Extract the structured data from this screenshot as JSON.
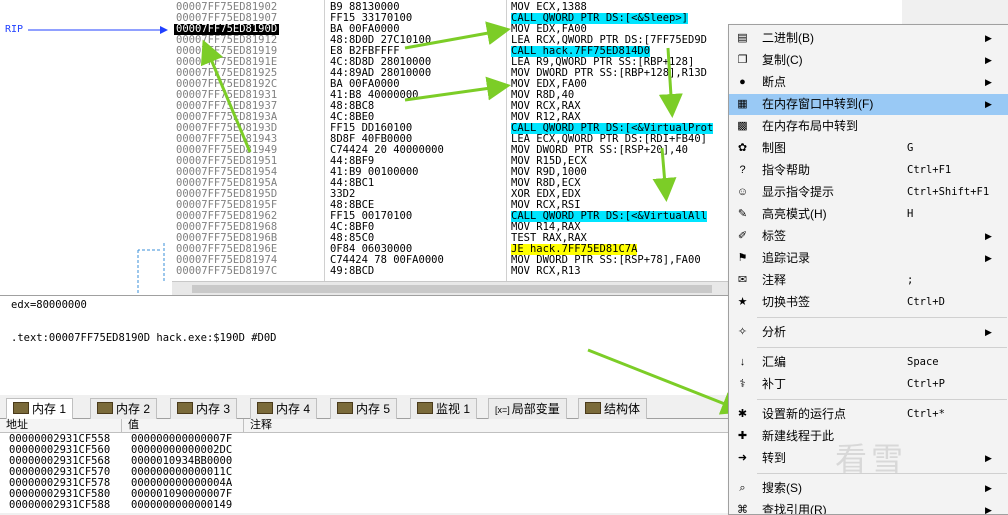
{
  "gutter": {
    "rip_label": "RIP"
  },
  "code_rows": [
    {
      "addr": "00007FF75ED81902",
      "bytes": "B9 88130000",
      "instr": "MOV ECX,1388",
      "hl": "",
      "cur": false
    },
    {
      "addr": "00007FF75ED81907",
      "bytes": "FF15 33170100",
      "instr": "CALL QWORD PTR DS:[<&Sleep>]",
      "hl": "call",
      "cur": false
    },
    {
      "addr": "00007FF75ED8190D",
      "bytes": "BA 00FA0000",
      "instr": "MOV EDX,FA00",
      "hl": "",
      "cur": true
    },
    {
      "addr": "00007FF75ED81912",
      "bytes": "48:8D0D 27C10100",
      "instr": "LEA RCX,QWORD PTR DS:[7FF75ED9D",
      "hl": "",
      "cur": false
    },
    {
      "addr": "00007FF75ED81919",
      "bytes": "E8 B2FBFFFF",
      "instr": "CALL hack.7FF75ED814D0",
      "hl": "call",
      "cur": false
    },
    {
      "addr": "00007FF75ED8191E",
      "bytes": "4C:8D8D 28010000",
      "instr": "LEA R9,QWORD PTR SS:[RBP+128]",
      "hl": "",
      "cur": false
    },
    {
      "addr": "00007FF75ED81925",
      "bytes": "44:89AD 28010000",
      "instr": "MOV DWORD PTR SS:[RBP+128],R13D",
      "hl": "",
      "cur": false
    },
    {
      "addr": "00007FF75ED8192C",
      "bytes": "BA 00FA0000",
      "instr": "MOV EDX,FA00",
      "hl": "",
      "cur": false
    },
    {
      "addr": "00007FF75ED81931",
      "bytes": "41:B8 40000000",
      "instr": "MOV R8D,40",
      "hl": "",
      "cur": false
    },
    {
      "addr": "00007FF75ED81937",
      "bytes": "48:8BC8",
      "instr": "MOV RCX,RAX",
      "hl": "",
      "cur": false
    },
    {
      "addr": "00007FF75ED8193A",
      "bytes": "4C:8BE0",
      "instr": "MOV R12,RAX",
      "hl": "",
      "cur": false
    },
    {
      "addr": "00007FF75ED8193D",
      "bytes": "FF15 DD160100",
      "instr": "CALL QWORD PTR DS:[<&VirtualProt",
      "hl": "call",
      "cur": false
    },
    {
      "addr": "00007FF75ED81943",
      "bytes": "8D8F 40FB0000",
      "instr": "LEA ECX,QWORD PTR DS:[RDI+FB40]",
      "hl": "",
      "cur": false
    },
    {
      "addr": "00007FF75ED81949",
      "bytes": "C74424 20 40000000",
      "instr": "MOV DWORD PTR SS:[RSP+20],40",
      "hl": "",
      "cur": false
    },
    {
      "addr": "00007FF75ED81951",
      "bytes": "44:8BF9",
      "instr": "MOV R15D,ECX",
      "hl": "",
      "cur": false
    },
    {
      "addr": "00007FF75ED81954",
      "bytes": "41:B9 00100000",
      "instr": "MOV R9D,1000",
      "hl": "",
      "cur": false
    },
    {
      "addr": "00007FF75ED8195A",
      "bytes": "44:8BC1",
      "instr": "MOV R8D,ECX",
      "hl": "",
      "cur": false
    },
    {
      "addr": "00007FF75ED8195D",
      "bytes": "33D2",
      "instr": "XOR EDX,EDX",
      "hl": "",
      "cur": false
    },
    {
      "addr": "00007FF75ED8195F",
      "bytes": "48:8BCE",
      "instr": "MOV RCX,RSI",
      "hl": "",
      "cur": false
    },
    {
      "addr": "00007FF75ED81962",
      "bytes": "FF15 00170100",
      "instr": "CALL QWORD PTR DS:[<&VirtualAll",
      "hl": "call",
      "cur": false
    },
    {
      "addr": "00007FF75ED81968",
      "bytes": "4C:8BF0",
      "instr": "MOV R14,RAX",
      "hl": "",
      "cur": false
    },
    {
      "addr": "00007FF75ED8196B",
      "bytes": "48:85C0",
      "instr": "TEST RAX,RAX",
      "hl": "",
      "cur": false
    },
    {
      "addr": "00007FF75ED8196E",
      "bytes": "0F84 06030000",
      "instr": "JE hack.7FF75ED81C7A",
      "hl": "jump",
      "cur": false
    },
    {
      "addr": "00007FF75ED81974",
      "bytes": "C74424 78 00FA0000",
      "instr": "MOV DWORD PTR SS:[RSP+78],FA00",
      "hl": "",
      "cur": false
    },
    {
      "addr": "00007FF75ED8197C",
      "bytes": "49:8BCD",
      "instr": "MOV RCX,R13",
      "hl": "",
      "cur": false
    }
  ],
  "info": {
    "line1": "edx=80000000",
    "line2": ".text:00007FF75ED8190D hack.exe:$190D #D0D"
  },
  "tabs": [
    {
      "label": "内存 1",
      "active": true
    },
    {
      "label": "内存 2",
      "active": false
    },
    {
      "label": "内存 3",
      "active": false
    },
    {
      "label": "内存 4",
      "active": false
    },
    {
      "label": "内存 5",
      "active": false
    },
    {
      "label": "监视 1",
      "active": false
    },
    {
      "label": "局部变量",
      "prefix": "[x=]",
      "active": false
    },
    {
      "label": "结构体",
      "active": false
    }
  ],
  "dump": {
    "headers": [
      "地址",
      "值",
      "注释"
    ],
    "rows": [
      {
        "addr": "00000002931CF558",
        "val": "000000000000007F"
      },
      {
        "addr": "00000002931CF560",
        "val": "00000000000002DC"
      },
      {
        "addr": "00000002931CF568",
        "val": "0000010934BB0000"
      },
      {
        "addr": "00000002931CF570",
        "val": "000000000000011C"
      },
      {
        "addr": "00000002931CF578",
        "val": "000000000000004A"
      },
      {
        "addr": "00000002931CF580",
        "val": "000001090000007F"
      },
      {
        "addr": "00000002931CF588",
        "val": "0000000000000149"
      }
    ]
  },
  "menu": [
    {
      "label": "二进制(B)",
      "shortcut": "",
      "arrow": true,
      "icon": "binary-icon",
      "glyph": "▤"
    },
    {
      "label": "复制(C)",
      "shortcut": "",
      "arrow": true,
      "icon": "copy-icon",
      "glyph": "❐"
    },
    {
      "label": "断点",
      "shortcut": "",
      "arrow": true,
      "icon": "breakpoint-icon",
      "glyph": "●"
    },
    {
      "label": "在内存窗口中转到(F)",
      "shortcut": "",
      "arrow": true,
      "icon": "memory-goto-icon",
      "glyph": "▦",
      "selected": true
    },
    {
      "label": "在内存布局中转到",
      "shortcut": "",
      "arrow": false,
      "icon": "memory-map-icon",
      "glyph": "▩"
    },
    {
      "label": "制图",
      "shortcut": "G",
      "arrow": false,
      "icon": "graph-icon",
      "glyph": "✿"
    },
    {
      "label": "指令帮助",
      "shortcut": "Ctrl+F1",
      "arrow": false,
      "icon": "help-icon",
      "glyph": "?"
    },
    {
      "label": "显示指令提示",
      "shortcut": "Ctrl+Shift+F1",
      "arrow": false,
      "icon": "hint-icon",
      "glyph": "☺"
    },
    {
      "label": "高亮模式(H)",
      "shortcut": "H",
      "arrow": false,
      "icon": "highlight-icon",
      "glyph": "✎"
    },
    {
      "label": "标签",
      "shortcut": "",
      "arrow": true,
      "icon": "label-icon",
      "glyph": "✐"
    },
    {
      "label": "追踪记录",
      "shortcut": "",
      "arrow": true,
      "icon": "trace-icon",
      "glyph": "⚑"
    },
    {
      "label": "注释",
      "shortcut": ";",
      "arrow": false,
      "icon": "comment-icon",
      "glyph": "✉"
    },
    {
      "label": "切换书签",
      "shortcut": "Ctrl+D",
      "arrow": false,
      "icon": "bookmark-icon",
      "glyph": "★",
      "sep_after": true
    },
    {
      "label": "分析",
      "shortcut": "",
      "arrow": true,
      "icon": "analyze-icon",
      "glyph": "✧",
      "sep_after": true
    },
    {
      "label": "汇编",
      "shortcut": "Space",
      "arrow": false,
      "icon": "assemble-icon",
      "glyph": "↓"
    },
    {
      "label": "补丁",
      "shortcut": "Ctrl+P",
      "arrow": false,
      "icon": "patch-icon",
      "glyph": "⚕",
      "sep_after": true
    },
    {
      "label": "设置新的运行点",
      "shortcut": "Ctrl+*",
      "arrow": false,
      "icon": "new-origin-icon",
      "glyph": "✱"
    },
    {
      "label": "新建线程于此",
      "shortcut": "",
      "arrow": false,
      "icon": "new-thread-icon",
      "glyph": "✚"
    },
    {
      "label": "转到",
      "shortcut": "",
      "arrow": true,
      "icon": "goto-icon",
      "glyph": "➜",
      "sep_after": true
    },
    {
      "label": "搜索(S)",
      "shortcut": "",
      "arrow": true,
      "icon": "search-icon",
      "glyph": "⌕"
    },
    {
      "label": "查找引用(R)",
      "shortcut": "",
      "arrow": true,
      "icon": "references-icon",
      "glyph": "⌘"
    }
  ],
  "watermark": "看雪",
  "colors": {
    "call_bg": "#00e5ff",
    "jump_bg": "#ffff00",
    "menu_selected": "#99c9f5",
    "arrow": "#7ccd27"
  }
}
